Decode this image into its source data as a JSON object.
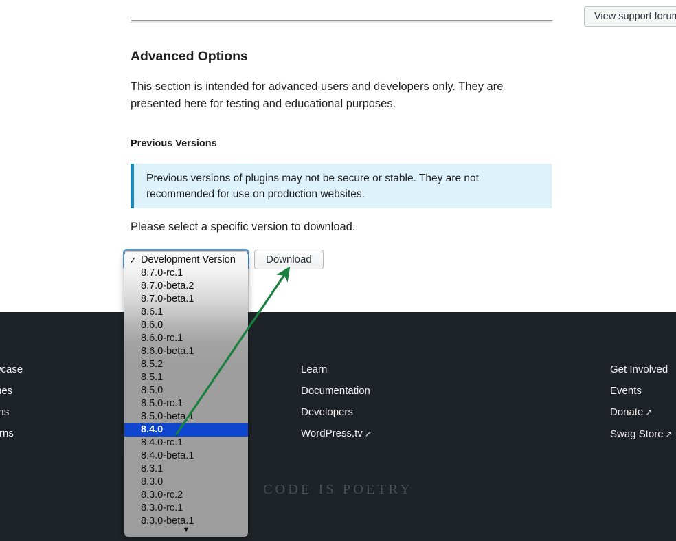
{
  "header": {
    "support_button_label": "View support forums"
  },
  "main": {
    "section_title": "Advanced Options",
    "intro_paragraph": "This section is intended for advanced users and developers only. They are presented here for testing and educational purposes.",
    "sub_title": "Previous Versions",
    "notice_text": "Previous versions of plugins may not be secure or stable. They are not recommended for use on production websites.",
    "select_lead_text": "Please select a specific version to download.",
    "download_button_label": "Download"
  },
  "version_dropdown": {
    "selected_value": "8.4.0",
    "checked_value": "Development Version",
    "scroll_down_glyph": "▼",
    "check_glyph": "✓",
    "highlight_color": "#0d45cf",
    "options": [
      "Development Version",
      "8.7.0-rc.1",
      "8.7.0-beta.2",
      "8.7.0-beta.1",
      "8.6.1",
      "8.6.0",
      "8.6.0-rc.1",
      "8.6.0-beta.1",
      "8.5.2",
      "8.5.1",
      "8.5.0",
      "8.5.0-rc.1",
      "8.5.0-beta.1",
      "8.4.0",
      "8.4.0-rc.1",
      "8.4.0-beta.1",
      "8.3.1",
      "8.3.0",
      "8.3.0-rc.2",
      "8.3.0-rc.1",
      "8.3.0-beta.1"
    ]
  },
  "annotation": {
    "arrow_color": "#1a8040"
  },
  "footer": {
    "columns": [
      {
        "links": [
          {
            "label": "Showcase",
            "external": false
          },
          {
            "label": "Themes",
            "external": false
          },
          {
            "label": "Plugins",
            "external": false
          },
          {
            "label": "Patterns",
            "external": false
          }
        ]
      },
      {
        "links": [
          {
            "label": "Learn",
            "external": false
          },
          {
            "label": "Documentation",
            "external": false
          },
          {
            "label": "Developers",
            "external": false
          },
          {
            "label": "WordPress.tv",
            "external": true
          }
        ]
      },
      {
        "links": [
          {
            "label": "Get Involved",
            "external": false
          },
          {
            "label": "Events",
            "external": false
          },
          {
            "label": "Donate",
            "external": true
          },
          {
            "label": "Swag Store",
            "external": true
          }
        ]
      }
    ],
    "external_glyph": "↗",
    "tagline": "CODE IS POETRY"
  }
}
